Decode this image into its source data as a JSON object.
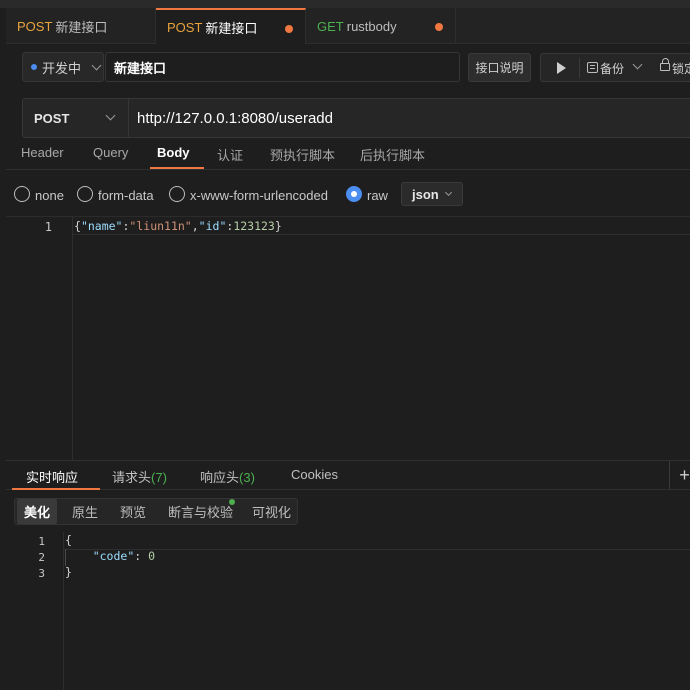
{
  "tabs": [
    {
      "method": "POST",
      "name": "新建接口",
      "active": false
    },
    {
      "method": "POST",
      "name": "新建接口",
      "active": true
    },
    {
      "method": "GET",
      "name": "rustbody",
      "active": false
    }
  ],
  "toolbar": {
    "status_label": "开发中",
    "name_value": "新建接口",
    "doc_label": "接口说明",
    "backup_label": "备份",
    "lock_label": "锁定"
  },
  "request": {
    "method": "POST",
    "url": "http://127.0.0.1:8080/useradd"
  },
  "request_tabs": [
    "Header",
    "Query",
    "Body",
    "认证",
    "预执行脚本",
    "后执行脚本"
  ],
  "active_request_tab": "Body",
  "body_types": [
    {
      "label": "none",
      "checked": false
    },
    {
      "label": "form-data",
      "checked": false
    },
    {
      "label": "x-www-form-urlencoded",
      "checked": false
    },
    {
      "label": "raw",
      "checked": true
    }
  ],
  "raw_format": "json",
  "request_body": {
    "line_number": "1",
    "tokens": [
      {
        "t": "{",
        "c": "pun"
      },
      {
        "t": "\"name\"",
        "c": "key"
      },
      {
        "t": ":",
        "c": "pun"
      },
      {
        "t": "\"liun11n\"",
        "c": "str"
      },
      {
        "t": ",",
        "c": "pun"
      },
      {
        "t": "\"id\"",
        "c": "key"
      },
      {
        "t": ":",
        "c": "pun"
      },
      {
        "t": "123123",
        "c": "num"
      },
      {
        "t": "}",
        "c": "pun"
      }
    ]
  },
  "response_tabs": {
    "realtime": "实时响应",
    "req_headers": "请求头",
    "req_headers_count": "(7)",
    "resp_headers": "响应头",
    "resp_headers_count": "(3)",
    "cookies": "Cookies",
    "add": "+"
  },
  "view_tabs": [
    "美化",
    "原生",
    "预览",
    "断言与校验",
    "可视化"
  ],
  "response_body": {
    "line_numbers": [
      "1",
      "2",
      "3"
    ],
    "line1": "{",
    "line2_key": "\"code\"",
    "line2_colon": ": ",
    "line2_value": "0",
    "line3": "}"
  },
  "colors": {
    "accent": "#f07840",
    "post": "#e8a33d",
    "get": "#4caf50",
    "radio_checked": "#4b8ef0"
  }
}
